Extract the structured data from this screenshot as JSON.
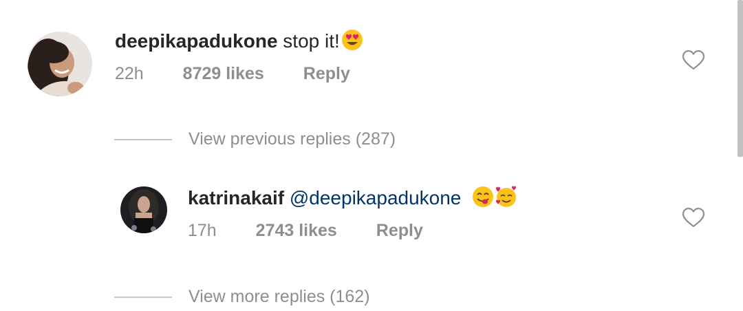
{
  "comment": {
    "username": "deepikapadukone",
    "text": "stop it!",
    "emoji": "smiling-face-with-heart-eyes",
    "time": "22h",
    "likes": "8729 likes",
    "reply_label": "Reply"
  },
  "view_previous": {
    "label": "View previous replies (287)"
  },
  "reply": {
    "username": "katrinakaif",
    "mention": "@deepikapadukone",
    "emojis": [
      "face-savoring-food",
      "smiling-face-with-hearts"
    ],
    "time": "17h",
    "likes": "2743 likes",
    "reply_label": "Reply"
  },
  "view_more": {
    "label": "View more replies (162)"
  },
  "colors": {
    "text": "#262626",
    "muted": "#8e8e8e",
    "mention": "#003569"
  }
}
